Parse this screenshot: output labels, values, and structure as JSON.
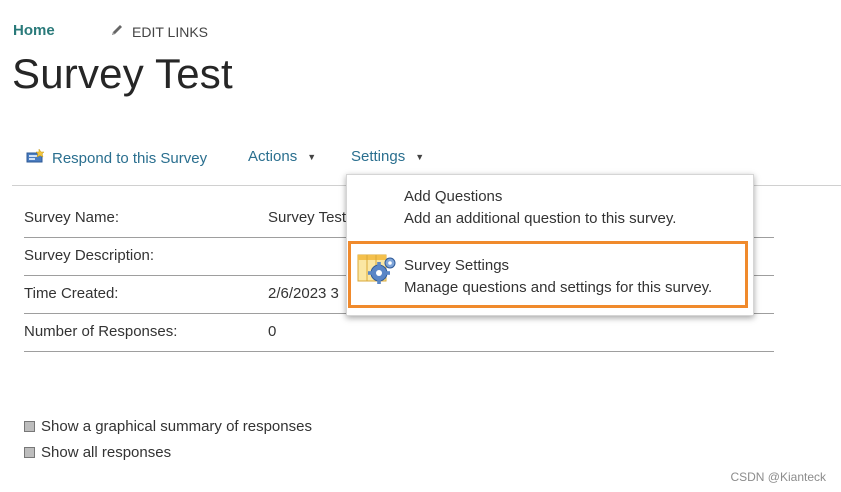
{
  "breadcrumb": {
    "home": "Home",
    "edit_links": "EDIT LINKS"
  },
  "page": {
    "title": "Survey Test"
  },
  "toolbar": {
    "respond": "Respond to this Survey",
    "actions": "Actions",
    "settings": "Settings"
  },
  "properties": [
    {
      "label": "Survey Name:",
      "value": "Survey Test"
    },
    {
      "label": "Survey Description:",
      "value": ""
    },
    {
      "label": "Time Created:",
      "value": "2/6/2023 3"
    },
    {
      "label": "Number of Responses:",
      "value": "0"
    }
  ],
  "links": {
    "graphical_summary": "Show a graphical summary of responses",
    "all_responses": "Show all responses"
  },
  "settings_menu": {
    "items": [
      {
        "title": "Add Questions",
        "description": "Add an additional question to this survey."
      },
      {
        "title": "Survey Settings",
        "description": "Manage questions and settings for this survey."
      }
    ]
  },
  "colors": {
    "highlight": "#f08a2c",
    "link": "#2a6f8f",
    "home": "#2a7a7a"
  },
  "watermark": "CSDN @Kianteck"
}
